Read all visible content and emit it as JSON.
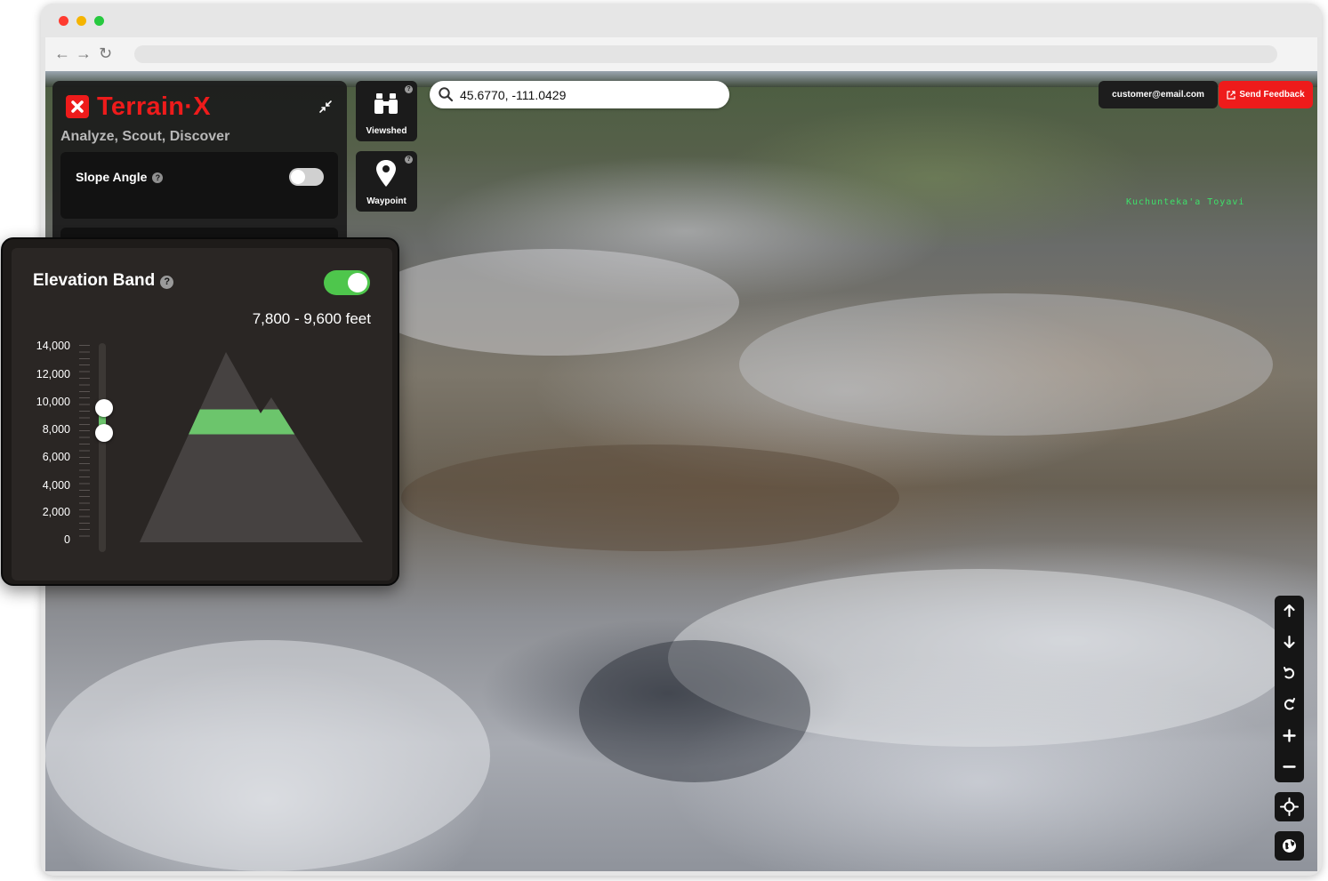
{
  "browser": {
    "url": ""
  },
  "search": {
    "value": "45.6770, -111.0429"
  },
  "header": {
    "account_email": "customer@email.com",
    "feedback_label": "Send Feedback"
  },
  "brand": {
    "name": "Terrain·X",
    "tagline": "Analyze, Scout, Discover",
    "accent_color": "#ee1b1b"
  },
  "tools": {
    "viewshed_label": "Viewshed",
    "waypoint_label": "Waypoint"
  },
  "layers": {
    "slope_angle_label": "Slope Angle",
    "slope_angle_enabled": false
  },
  "map": {
    "place_label": "Kuchunteka'a Toyavi"
  },
  "elevation_band": {
    "title": "Elevation Band",
    "enabled": true,
    "range_text": "7,800 - 9,600 feet",
    "low_feet": 7800,
    "high_feet": 9600,
    "band_color": "#6cc56c",
    "toggle_color": "#4ec64c",
    "scale_labels": [
      "14,000",
      "12,000",
      "10,000",
      "8,000",
      "6,000",
      "4,000",
      "2,000",
      "0"
    ]
  },
  "map_controls": [
    "pan-up",
    "pan-down",
    "rotate-left",
    "rotate-right",
    "zoom-in",
    "zoom-out",
    "locate",
    "globe"
  ]
}
